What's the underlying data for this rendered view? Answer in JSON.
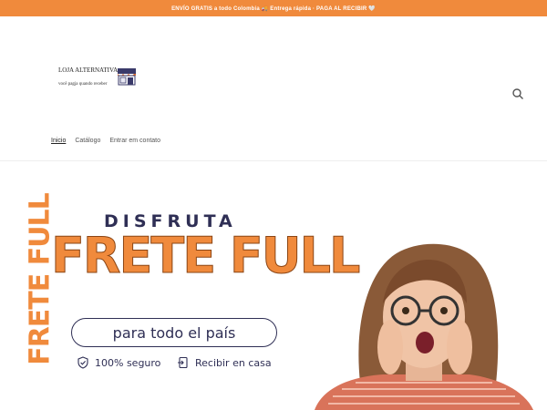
{
  "announcement": "ENVÍO GRATIS a todo Colombia 🚚 Entrega rápida · PAGA AL RECIBIR 🤍",
  "logo": {
    "title": "LOJA ALTERNATIVA",
    "tagline": "você pagja quando receber"
  },
  "nav": {
    "items": [
      "Inicio",
      "Catálogo",
      "Entrar em contato"
    ]
  },
  "hero": {
    "vertical_text": "FRETE FULL",
    "headline_small": "DISFRUTA",
    "headline_big": "FRETE FULL",
    "pill_text": "para todo el país",
    "features": [
      "100% seguro",
      "Recibir en casa"
    ]
  },
  "colors": {
    "accent": "#f08a3c",
    "navy": "#2f2f55"
  },
  "icons": [
    "search-icon",
    "store-icon",
    "shield-check-icon",
    "door-enter-icon"
  ]
}
